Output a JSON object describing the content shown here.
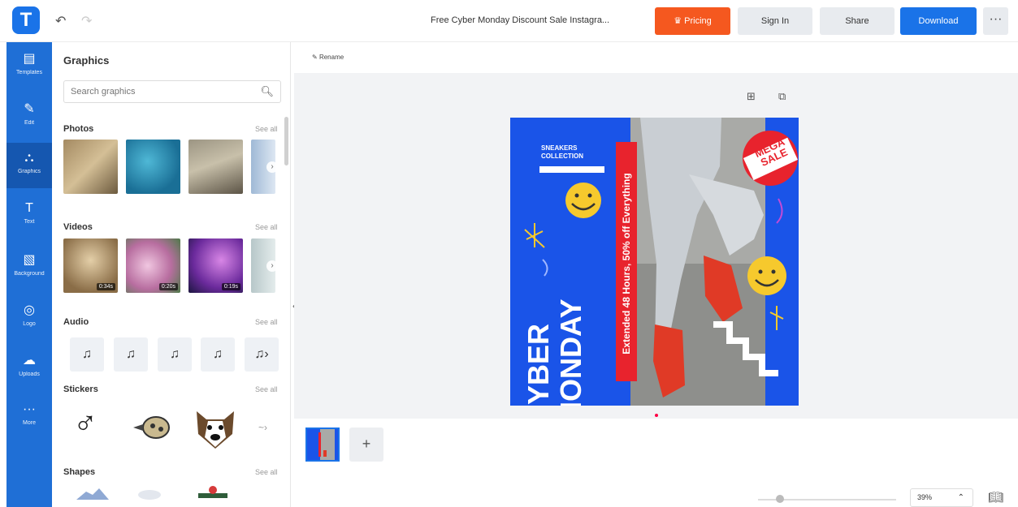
{
  "header": {
    "doc_title": "Free Cyber Monday Discount Sale Instagra...",
    "pricing_label": "Pricing",
    "signin_label": "Sign In",
    "share_label": "Share",
    "download_label": "Download",
    "more_label": "···"
  },
  "rail": {
    "items": [
      {
        "label": "Templates",
        "icon": "layout-icon",
        "glyph": "▤"
      },
      {
        "label": "Edit",
        "icon": "pencil-icon",
        "glyph": "✎"
      },
      {
        "label": "Graphics",
        "icon": "shapes-icon",
        "glyph": "⛬"
      },
      {
        "label": "Text",
        "icon": "text-icon",
        "glyph": "T"
      },
      {
        "label": "Background",
        "icon": "background-icon",
        "glyph": "▧"
      },
      {
        "label": "Logo",
        "icon": "logo-icon",
        "glyph": "◎"
      },
      {
        "label": "Uploads",
        "icon": "cloud-upload-icon",
        "glyph": "☁"
      },
      {
        "label": "More",
        "icon": "more-icon",
        "glyph": "···"
      }
    ],
    "active_index": 2
  },
  "panel": {
    "title": "Graphics",
    "search_placeholder": "Search graphics",
    "sections": {
      "photos": {
        "title": "Photos",
        "see_all": "See all"
      },
      "videos": {
        "title": "Videos",
        "see_all": "See all",
        "durations": [
          "0:34s",
          "0:20s",
          "0:19s"
        ]
      },
      "audio": {
        "title": "Audio",
        "see_all": "See all"
      },
      "stickers": {
        "title": "Stickers",
        "see_all": "See all"
      },
      "shapes": {
        "title": "Shapes",
        "see_all": "See all"
      }
    }
  },
  "canvas": {
    "rename_label": "Rename",
    "poster": {
      "shoes_label_1": "SNEAKERS",
      "shoes_label_2": "COLLECTION",
      "headline_1": "CYBER",
      "headline_2": "MONDAY",
      "ribbon_text": "Extended 48 Hours, 50% off Everything",
      "badge_1": "MEGA",
      "badge_2": "SALE"
    }
  },
  "footer": {
    "add_page_label": "+",
    "zoom_value": "39%"
  },
  "colors": {
    "brand_blue": "#1a73e8",
    "pricing_orange": "#f5581f",
    "poster_blue": "#1a54e8",
    "poster_red": "#e8232d"
  }
}
